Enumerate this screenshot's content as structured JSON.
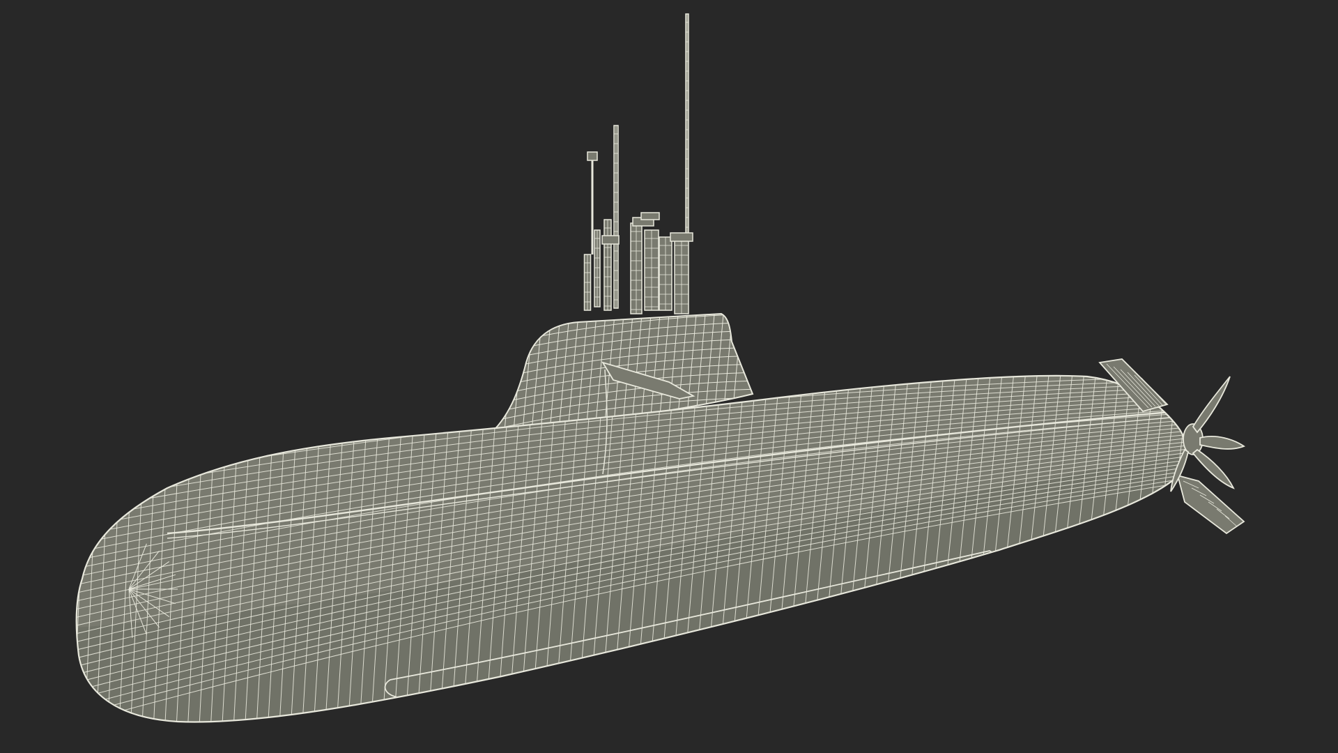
{
  "scene": {
    "subject": "submarine-wireframe",
    "colors": {
      "background": "#282828",
      "surface": "#797a6f",
      "surface_shadow": "#6a6b61",
      "wire": "#e8e8dc"
    }
  }
}
